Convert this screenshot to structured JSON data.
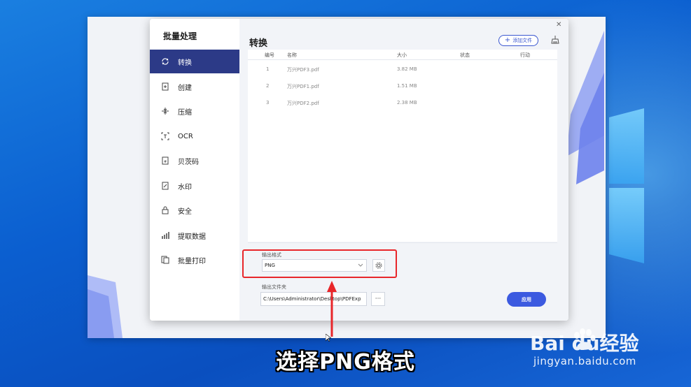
{
  "sidebar": {
    "title": "批量处理",
    "items": [
      {
        "label": "转换",
        "icon": "convert-icon",
        "active": true
      },
      {
        "label": "创建",
        "icon": "create-icon"
      },
      {
        "label": "压缩",
        "icon": "compress-icon"
      },
      {
        "label": "OCR",
        "icon": "ocr-icon"
      },
      {
        "label": "贝茨码",
        "icon": "bates-icon"
      },
      {
        "label": "水印",
        "icon": "watermark-icon"
      },
      {
        "label": "安全",
        "icon": "lock-icon"
      },
      {
        "label": "提取数据",
        "icon": "extract-data-icon"
      },
      {
        "label": "批量打印",
        "icon": "print-icon"
      }
    ]
  },
  "main": {
    "title": "转换",
    "add_file_label": "添加文件",
    "columns": [
      "编号",
      "名称",
      "大小",
      "状态",
      "行动"
    ],
    "rows": [
      {
        "no": "1",
        "name": "万兴PDF3.pdf",
        "size": "3.82 MB"
      },
      {
        "no": "2",
        "name": "万兴PDF1.pdf",
        "size": "1.51 MB"
      },
      {
        "no": "3",
        "name": "万兴PDF2.pdf",
        "size": "2.38 MB"
      }
    ],
    "output_format_label": "输出格式",
    "output_format_value": "PNG",
    "output_folder_label": "输出文件夹",
    "output_folder_value": "C:\\Users\\Administrator\\Desktop\\PDFExp",
    "browse_label": "···",
    "apply_label": "应用"
  },
  "caption": "选择PNG格式",
  "watermark": {
    "brand": "Bai  du经验",
    "url": "jingyan.baidu.com"
  },
  "colors": {
    "accent": "#3c5ae0",
    "sidebar_active": "#2c3a87",
    "highlight": "#e8262a"
  }
}
